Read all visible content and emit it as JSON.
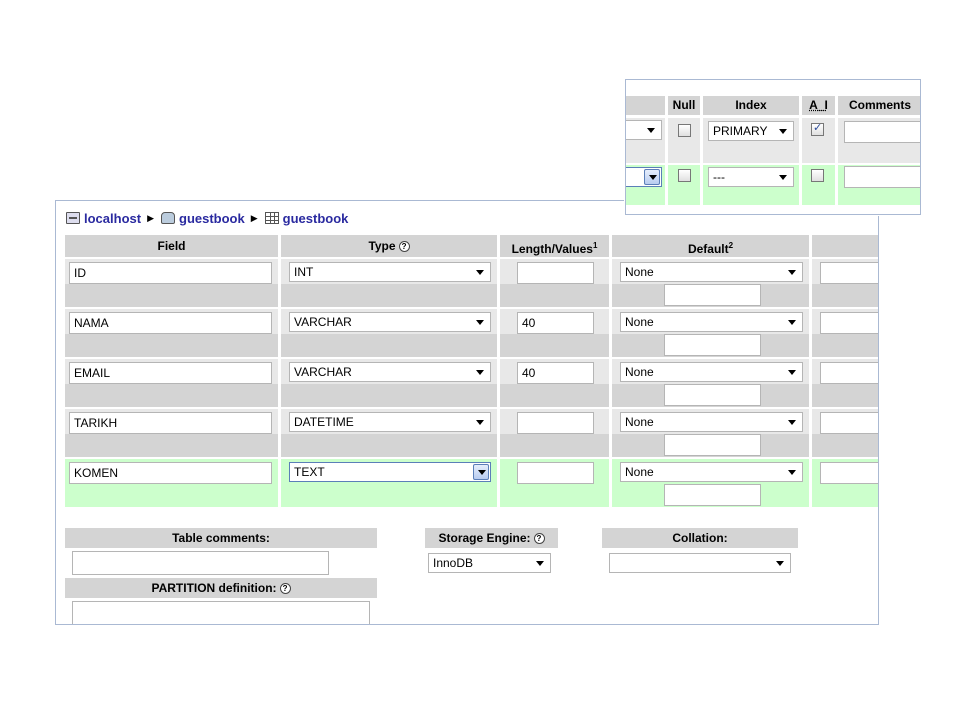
{
  "breadcrumb": {
    "server": "localhost",
    "database": "guestbook",
    "table": "guestbook"
  },
  "columns": {
    "field": "Field",
    "type": "Type",
    "length": "Length/Values",
    "length_sup": "1",
    "default": "Default",
    "default_sup": "2"
  },
  "rows": [
    {
      "field": "ID",
      "type": "INT",
      "length": "",
      "default": "None"
    },
    {
      "field": "NAMA",
      "type": "VARCHAR",
      "length": "40",
      "default": "None"
    },
    {
      "field": "EMAIL",
      "type": "VARCHAR",
      "length": "40",
      "default": "None"
    },
    {
      "field": "TARIKH",
      "type": "DATETIME",
      "length": "",
      "default": "None"
    },
    {
      "field": "KOMEN",
      "type": "TEXT",
      "length": "",
      "default": "None"
    }
  ],
  "bottom": {
    "table_comments": "Table comments:",
    "storage_engine": "Storage Engine:",
    "storage_engine_value": "InnoDB",
    "collation": "Collation:",
    "collation_value": "",
    "partition": "PARTITION definition:"
  },
  "inset": {
    "null": "Null",
    "index": "Index",
    "ai": "A_I",
    "comments": "Comments",
    "row1_index": "PRIMARY",
    "row1_ai_checked": true,
    "row2_index": "---"
  },
  "colors": {
    "header_gray": "#d4d4d4",
    "row_gray": "#d9d9d9",
    "highlight_green": "#ccffcc",
    "link_blue": "#2a2aa0",
    "panel_border": "#aab9d3"
  },
  "icons": [
    "server-icon",
    "database-icon",
    "table-icon",
    "help-icon",
    "chevron-down-icon",
    "checkbox"
  ]
}
